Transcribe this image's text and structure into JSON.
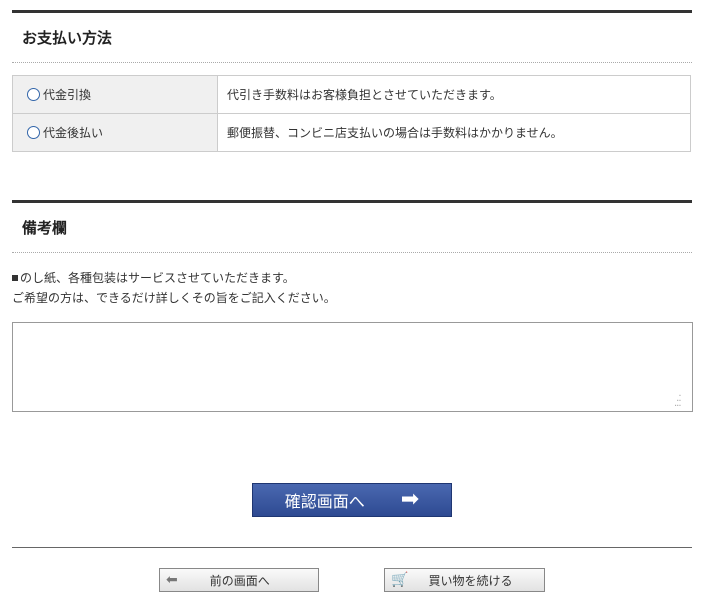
{
  "payment": {
    "title": "お支払い方法",
    "options": [
      {
        "label": "代金引換",
        "description": "代引き手数料はお客様負担とさせていただきます。"
      },
      {
        "label": "代金後払い",
        "description": "郵便振替、コンビニ店支払いの場合は手数料はかかりません。"
      }
    ]
  },
  "remarks": {
    "title": "備考欄",
    "note_line1": "のし紙、各種包装はサービスさせていただきます。",
    "note_line2": "ご希望の方は、できるだけ詳しくその旨をご記入ください。",
    "textarea_value": ""
  },
  "buttons": {
    "confirm_label": "確認画面へ",
    "back_label": "前の画面へ",
    "continue_label": "買い物を続ける"
  },
  "icons": {
    "radio": "radio-circle-icon",
    "confirm_arrow": "arrow-right-icon",
    "back_arrow": "arrow-left-icon",
    "cart": "shopping-cart-icon"
  },
  "colors": {
    "confirm_button": "#3a5aa2",
    "section_border": "#333333",
    "label_bg": "#f0f0f0"
  }
}
